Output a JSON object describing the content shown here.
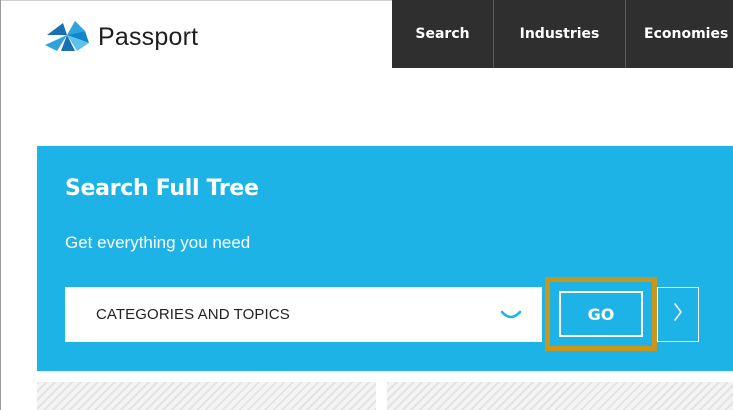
{
  "header": {
    "logo_text": "Passport"
  },
  "nav": {
    "items": [
      {
        "label": "Search"
      },
      {
        "label": "Industries"
      },
      {
        "label": "Economies"
      }
    ]
  },
  "search_panel": {
    "title": "Search Full Tree",
    "subtitle": "Get everything you need",
    "select_value": "CATEGORIES AND TOPICS",
    "go_label": "GO"
  },
  "colors": {
    "panel": "#1db3e6",
    "nav": "#2f2f2f",
    "highlight": "#c9961c"
  },
  "icons": {
    "logo": "passport-logo-icon",
    "dropdown": "chevron-down-icon",
    "next": "chevron-right-icon"
  }
}
